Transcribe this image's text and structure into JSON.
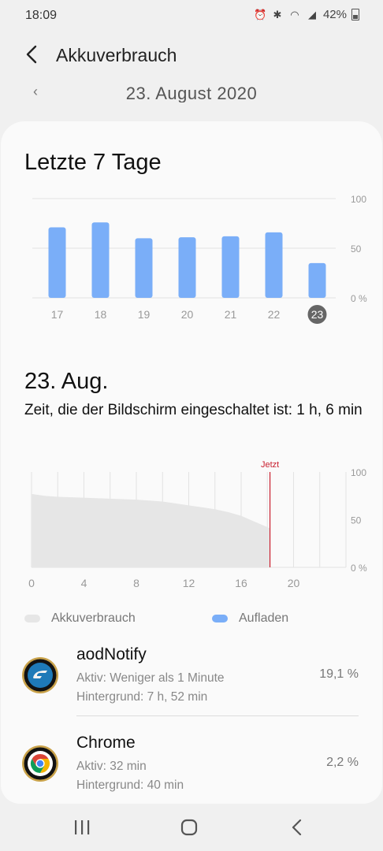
{
  "status_bar": {
    "time": "18:09",
    "battery": "42%"
  },
  "header": {
    "title": "Akkuverbrauch"
  },
  "date_peek": "23. August 2020",
  "week": {
    "title": "Letzte 7 Tage",
    "y_ticks": [
      "100",
      "50",
      "0 %"
    ],
    "days": [
      "17",
      "18",
      "19",
      "20",
      "21",
      "22",
      "23"
    ],
    "selected_day": "23"
  },
  "chart_data": [
    {
      "type": "bar",
      "categories": [
        "17",
        "18",
        "19",
        "20",
        "21",
        "22",
        "23"
      ],
      "values": [
        71,
        76,
        60,
        61,
        62,
        66,
        35
      ],
      "ylim": [
        0,
        100
      ],
      "y_ticks": [
        "100",
        "50",
        "0 %"
      ]
    },
    {
      "type": "area",
      "x": [
        0,
        1,
        2,
        4,
        6,
        8,
        9,
        10,
        11,
        12,
        13,
        14,
        15,
        16,
        17,
        18.2
      ],
      "y": [
        77,
        75,
        74,
        73,
        72,
        71,
        70,
        69,
        67,
        65,
        63,
        61,
        58,
        54,
        48,
        41
      ],
      "xlim": [
        0,
        24
      ],
      "ylim": [
        0,
        100
      ],
      "x_ticks": [
        "0",
        "4",
        "8",
        "12",
        "16",
        "20"
      ],
      "y_ticks": [
        "100",
        "50",
        "0 %"
      ],
      "marker": {
        "x": 18.2,
        "label": "Jetzt"
      }
    }
  ],
  "day": {
    "title": "23. Aug.",
    "screen_time": "Zeit, die der Bildschirm eingeschaltet ist: 1 h, 6 min"
  },
  "legend": {
    "usage": "Akkuverbrauch",
    "charging": "Aufladen"
  },
  "apps": [
    {
      "name": "aodNotify",
      "active": "Aktiv: Weniger als 1 Minute",
      "background": "Hintergrund: 7 h, 52 min",
      "percent": "19,1 %"
    },
    {
      "name": "Chrome",
      "active": "Aktiv: 32 min",
      "background": "Hintergrund: 40 min",
      "percent": "2,2 %"
    }
  ],
  "colors": {
    "bar": "#7aaef8",
    "selected_day_bg": "#666666",
    "area": "#e6e6e6",
    "now_line": "#c81e2e",
    "grid": "#e3e3e3"
  },
  "icons": {
    "back": "back-arrow-icon",
    "nav_recents": "recents-icon",
    "nav_home": "home-icon",
    "nav_back": "nav-back-icon"
  }
}
